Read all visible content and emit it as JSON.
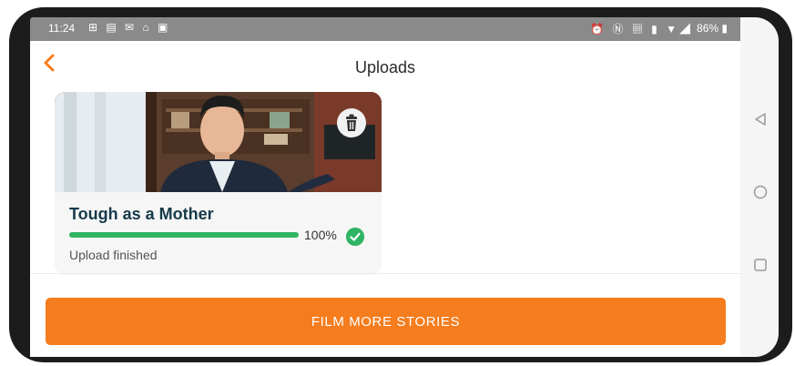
{
  "status_bar": {
    "time": "11:24",
    "battery": "86%",
    "left_icons": [
      "grid-icon",
      "calendar-icon",
      "gmail-icon",
      "home-icon",
      "image-icon"
    ],
    "right_icons": [
      "alarm-icon",
      "nfc-icon",
      "data-icon",
      "vibrate-icon",
      "wifi-icon",
      "signal-icon",
      "battery-icon"
    ]
  },
  "header": {
    "title": "Uploads",
    "back_icon": "chevron-left-icon"
  },
  "upload_card": {
    "title": "Tough as a Mother",
    "progress_label": "100%",
    "progress_fraction": 1.0,
    "status": "Upload finished",
    "delete_icon": "trash-icon",
    "complete_icon": "check-circle-icon"
  },
  "cta": {
    "label": "FILM MORE STORIES"
  },
  "colors": {
    "accent": "#f57d1e",
    "progress": "#2fb463",
    "title_text": "#163a4a"
  }
}
